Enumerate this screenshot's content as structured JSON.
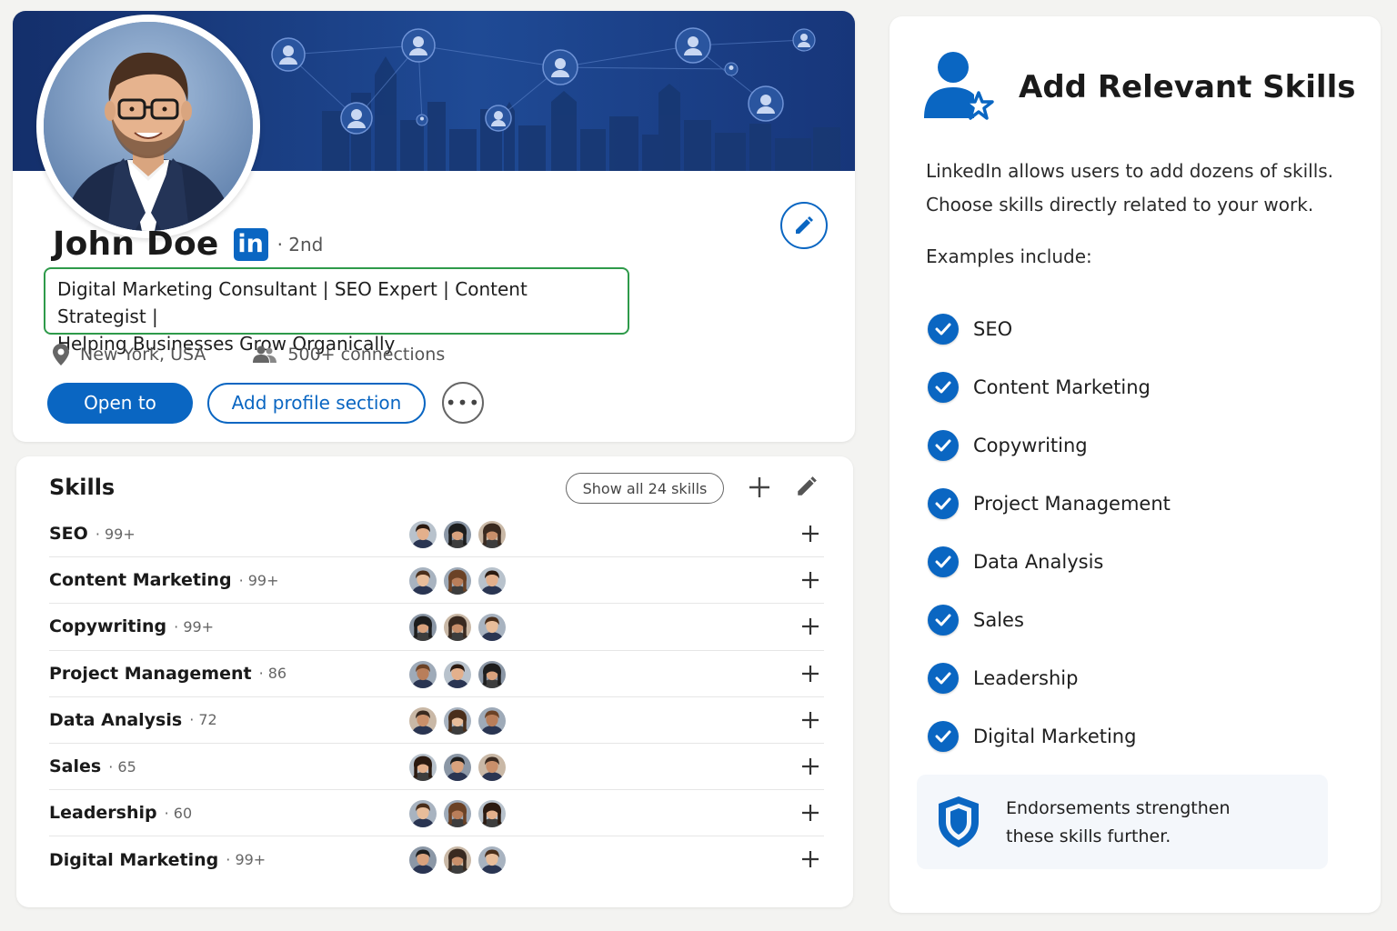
{
  "profile": {
    "name": "John Doe",
    "linkedin_badge": "in",
    "degree": "· 2nd",
    "headline_line1": "Digital Marketing Consultant | SEO Expert | Content Strategist |",
    "headline_line2": "Helping Businesses Grow Organically",
    "location": "New York, USA",
    "connections": "500+ connections",
    "open_to_label": "Open to",
    "add_section_label": "Add profile section",
    "more_label": "•••"
  },
  "skills": {
    "title": "Skills",
    "show_all_label": "Show all 24 skills",
    "items": [
      {
        "name": "SEO",
        "count": "· 99+"
      },
      {
        "name": "Content Marketing",
        "count": "· 99+"
      },
      {
        "name": "Copywriting",
        "count": "· 99+"
      },
      {
        "name": "Project Management",
        "count": "· 86"
      },
      {
        "name": "Data Analysis",
        "count": "· 72"
      },
      {
        "name": "Sales",
        "count": "· 65"
      },
      {
        "name": "Leadership",
        "count": "· 60"
      },
      {
        "name": "Digital Marketing",
        "count": "· 99+"
      }
    ]
  },
  "info": {
    "title": "Add Relevant Skills",
    "desc_line1": "LinkedIn allows users to add dozens of skills.",
    "desc_line2": "Choose skills directly related to your work.",
    "examples_label": "Examples include:",
    "examples": [
      "SEO",
      "Content Marketing",
      "Copywriting",
      "Project Management",
      "Data Analysis",
      "Sales",
      "Leadership",
      "Digital Marketing"
    ],
    "note_line1": "Endorsements strengthen",
    "note_line2": "these skills further."
  },
  "colors": {
    "accent": "#0a66c2",
    "banner": "#1f4a95",
    "headline_border": "#2e9a4a"
  }
}
